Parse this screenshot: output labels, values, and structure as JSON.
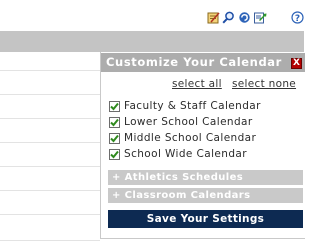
{
  "toolbar": {
    "icons": [
      "edit-icon",
      "search-icon",
      "sync-icon",
      "export-icon",
      "help-icon"
    ]
  },
  "panel": {
    "title": "Customize Your Calendar",
    "close_label": "X",
    "select_all": "select all",
    "select_none": "select none",
    "calendars": [
      {
        "label": "Faculty & Staff Calendar",
        "checked": true
      },
      {
        "label": "Lower School Calendar",
        "checked": true
      },
      {
        "label": "Middle School Calendar",
        "checked": true
      },
      {
        "label": "School Wide Calendar",
        "checked": true
      }
    ],
    "sections": [
      {
        "label": "+ Athletics Schedules"
      },
      {
        "label": "+ Classroom Calendars"
      }
    ],
    "save_label": "Save Your Settings"
  },
  "colors": {
    "panel_header": "#adadad",
    "save_button": "#0d2a52",
    "close_button": "#b30000",
    "check_mark": "#2f8a1e"
  }
}
